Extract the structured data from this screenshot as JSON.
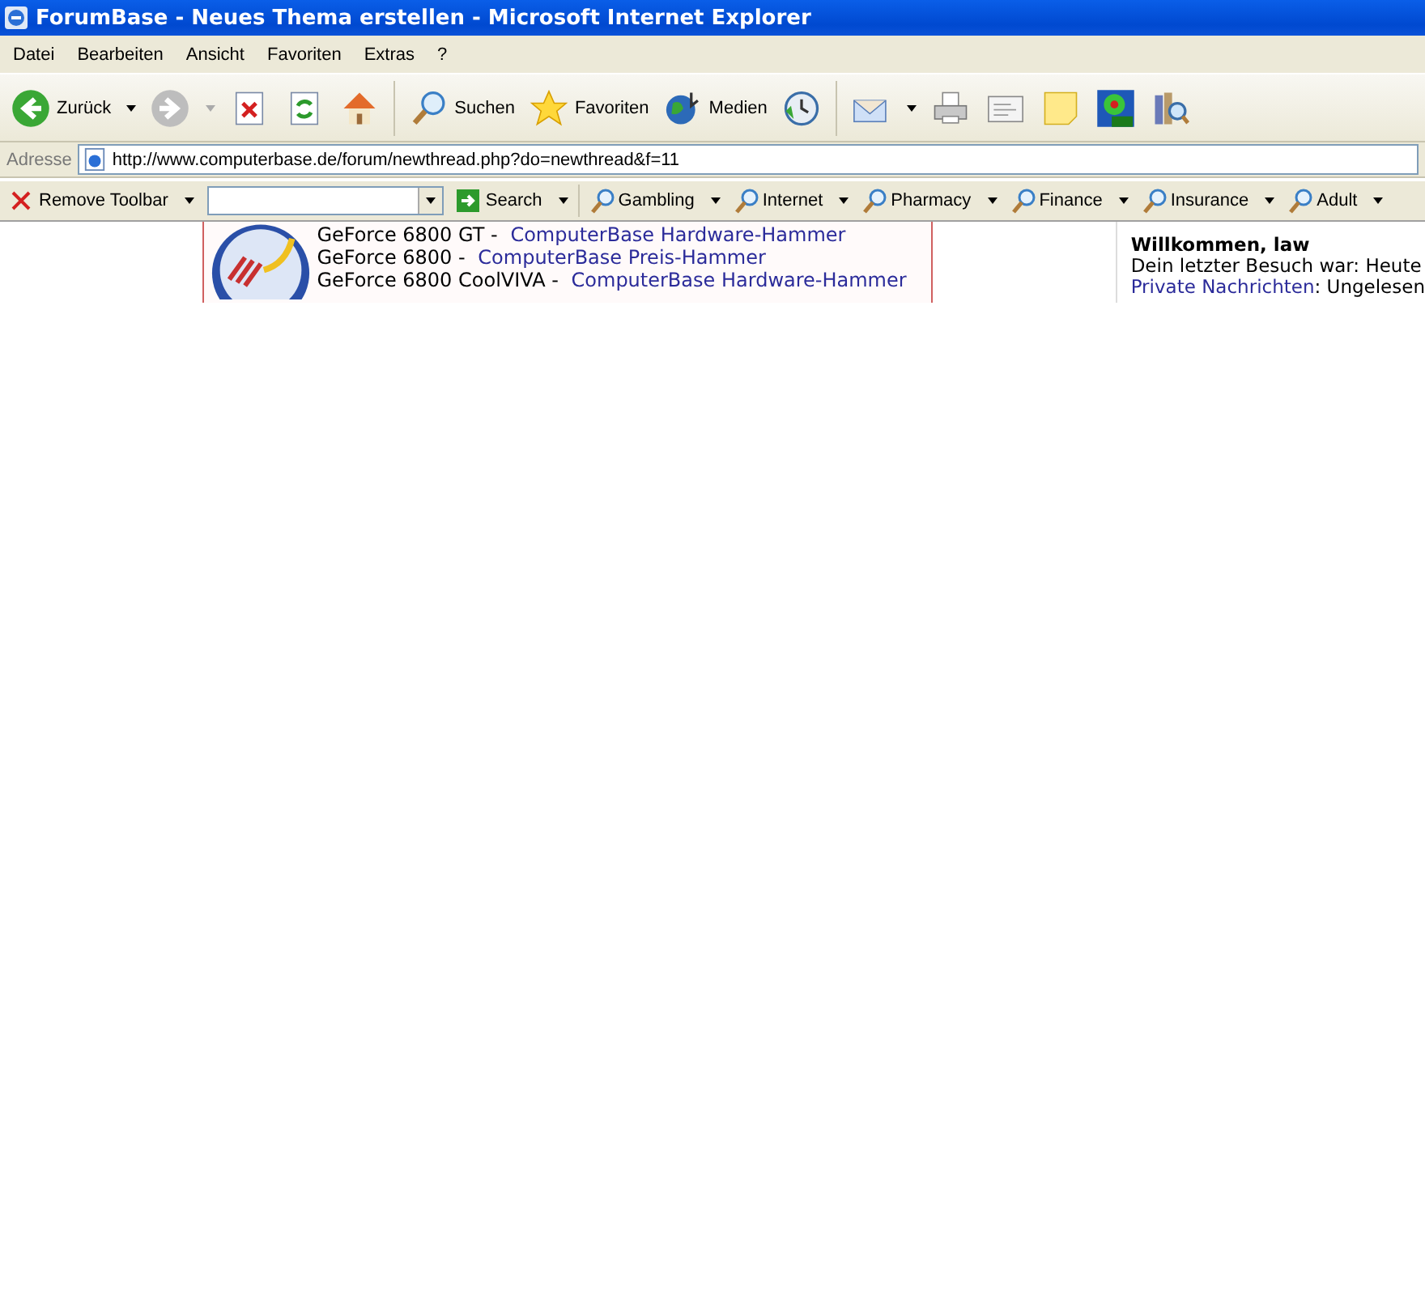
{
  "window": {
    "title": "ForumBase - Neues Thema erstellen - Microsoft Internet Explorer"
  },
  "menu": [
    "Datei",
    "Bearbeiten",
    "Ansicht",
    "Favoriten",
    "Extras",
    "?"
  ],
  "toolbar": [
    {
      "kind": "back",
      "label": "Zurück",
      "dropdown": true
    },
    {
      "kind": "forward",
      "dropdown": true
    },
    {
      "kind": "stop"
    },
    {
      "kind": "refresh"
    },
    {
      "kind": "home"
    },
    {
      "kind": "sep"
    },
    {
      "kind": "search",
      "label": "Suchen"
    },
    {
      "kind": "favorites",
      "label": "Favoriten"
    },
    {
      "kind": "media",
      "label": "Medien"
    },
    {
      "kind": "history"
    },
    {
      "kind": "sep"
    },
    {
      "kind": "mail",
      "dropdown": true
    },
    {
      "kind": "print"
    },
    {
      "kind": "edit"
    },
    {
      "kind": "note"
    },
    {
      "kind": "flower"
    },
    {
      "kind": "research"
    }
  ],
  "address": {
    "label": "Adresse",
    "url": "http://www.computerbase.de/forum/newthread.php?do=newthread&f=11"
  },
  "search_toolbar": {
    "remove_label": "Remove Toolbar",
    "search_label": "Search",
    "categories": [
      "Gambling",
      "Internet",
      "Pharmacy",
      "Finance",
      "Insurance",
      "Adult"
    ]
  },
  "banner": {
    "lines": [
      {
        "product": "GeForce 6800 GT -",
        "link": "ComputerBase Hardware-Hammer"
      },
      {
        "product": "GeForce 6800 -",
        "link": "ComputerBase Preis-Hammer"
      },
      {
        "product": "GeForce 6800 CoolVIVA -",
        "link": "ComputerBase Hardware-Hammer"
      }
    ]
  },
  "welcome": {
    "title": "Willkommen, law",
    "last_visit": "Dein letzter Besuch war: Heute",
    "pm_link": "Private Nachrichten",
    "pm_status": ": Ungelesen"
  }
}
